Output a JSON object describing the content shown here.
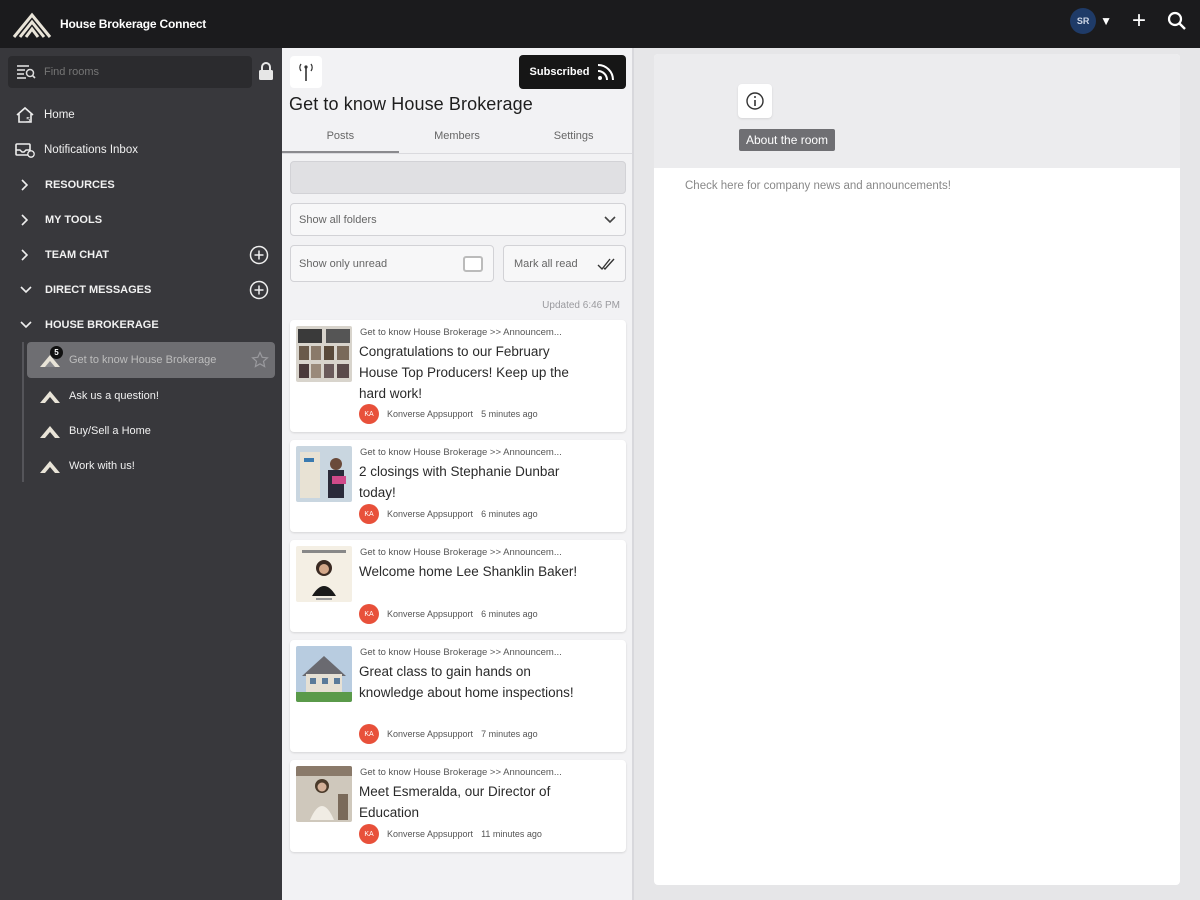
{
  "app": {
    "title": "House Brokerage Connect"
  },
  "topbar": {
    "avatar_initials": "SR",
    "icons": [
      "avatar",
      "plus-icon",
      "search-icon"
    ]
  },
  "sidebar": {
    "search_placeholder": "Find rooms",
    "nav": [
      {
        "label": "Home",
        "icon": "home-icon"
      },
      {
        "label": "Notifications Inbox",
        "icon": "inbox-icon"
      }
    ],
    "sections": [
      {
        "label": "RESOURCES",
        "expanded": false
      },
      {
        "label": "MY TOOLS",
        "expanded": false
      },
      {
        "label": "TEAM CHAT",
        "expanded": false,
        "add": true
      },
      {
        "label": "DIRECT MESSAGES",
        "expanded": true,
        "add": true
      },
      {
        "label": "HOUSE BROKERAGE",
        "expanded": true
      }
    ],
    "rooms": [
      {
        "label": "Get to know House Brokerage",
        "badge": "5",
        "active": true
      },
      {
        "label": "Ask us a question!"
      },
      {
        "label": "Buy/Sell a Home"
      },
      {
        "label": "Work with us!"
      }
    ]
  },
  "room": {
    "title": "Get to know House Brokerage",
    "subscribed_label": "Subscribed",
    "tabs": [
      "Posts",
      "Members",
      "Settings"
    ],
    "active_tab": "Posts",
    "folder_select": "Show all folders",
    "show_unread_label": "Show only unread",
    "mark_read_label": "Mark all read",
    "updated": "Updated 6:46 PM"
  },
  "posts": [
    {
      "crumb": "Get to know House Brokerage >> Announcem...",
      "title": "Congratulations to our February House Top Producers! Keep up the hard work!",
      "author": "Konverse Appsupport",
      "initials": "KA",
      "time": "5 minutes ago"
    },
    {
      "crumb": "Get to know House Brokerage >> Announcem...",
      "title": "2 closings with Stephanie Dunbar today!",
      "author": "Konverse Appsupport",
      "initials": "KA",
      "time": "6 minutes ago"
    },
    {
      "crumb": "Get to know House Brokerage >> Announcem...",
      "title": "Welcome home Lee Shanklin Baker!",
      "author": "Konverse Appsupport",
      "initials": "KA",
      "time": "6 minutes ago"
    },
    {
      "crumb": "Get to know House Brokerage >> Announcem...",
      "title": "Great class to gain hands on knowledge about home inspections!",
      "author": "Konverse Appsupport",
      "initials": "KA",
      "time": "7 minutes ago"
    },
    {
      "crumb": "Get to know House Brokerage >> Announcem...",
      "title": "Meet Esmeralda, our Director of Education",
      "author": "Konverse Appsupport",
      "initials": "KA",
      "time": "11 minutes ago"
    }
  ],
  "about": {
    "tooltip": "About the room",
    "description": "Check here for company news and announcements!"
  },
  "colors": {
    "accent_avatar": "#e8503a",
    "sidebar_bg": "#38383c",
    "topbar_bg": "#1b1b1d"
  }
}
